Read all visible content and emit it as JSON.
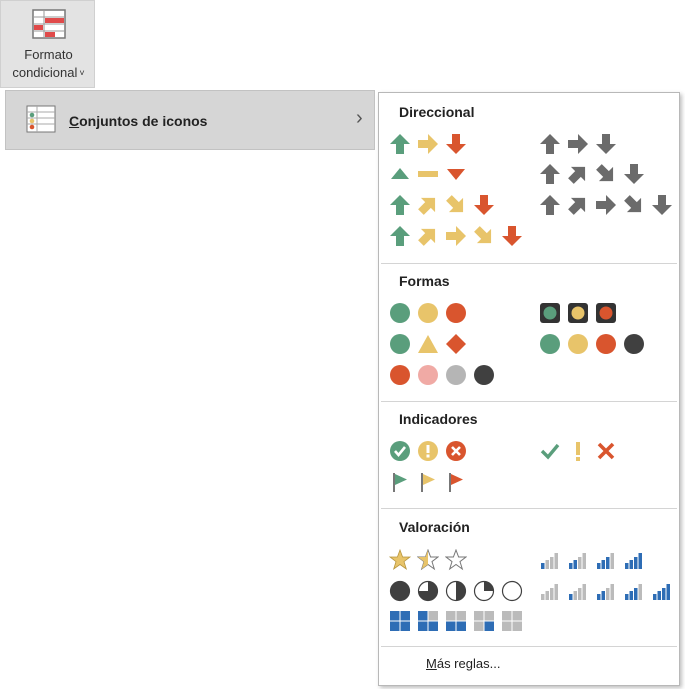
{
  "ribbon": {
    "button_label_line1": "Formato",
    "button_label_line2": "condicional",
    "caret": "˅",
    "icon": "conditional-format-icon"
  },
  "menu": {
    "icon_sets_item": {
      "label_first": "C",
      "label_rest": "onjuntos de iconos",
      "icon": "icon-set-menu-icon",
      "submenu_arrow": "›"
    }
  },
  "flyout": {
    "sections": {
      "directional": "Direccional",
      "shapes": "Formas",
      "indicators": "Indicadores",
      "ratings": "Valoración"
    },
    "more_rules": {
      "label_first": "M",
      "label_rest": "ás reglas..."
    }
  },
  "colors": {
    "green": "#5a9e7c",
    "yellow": "#e8c46a",
    "red": "#d9552e",
    "gray": "#6b6b6b",
    "dark": "#404040",
    "light_gray": "#b5b5b5",
    "pink": "#f0aaa5",
    "blue": "#2e6db5",
    "menu_highlight": "#d6d6d6"
  }
}
